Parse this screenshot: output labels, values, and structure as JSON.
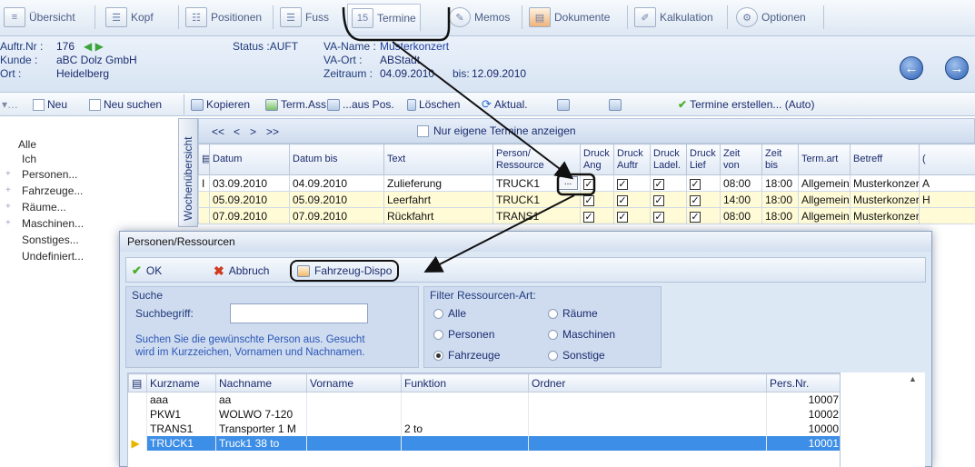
{
  "tabs": [
    {
      "label": "Übersicht",
      "icon": "overview-icon"
    },
    {
      "label": "Kopf",
      "icon": "header-doc-icon"
    },
    {
      "label": "Positionen",
      "icon": "positions-icon"
    },
    {
      "label": "Fuss",
      "icon": "footer-doc-icon"
    },
    {
      "label": "Termine",
      "icon": "calendar-icon",
      "icon_text": "15"
    },
    {
      "label": "Memos",
      "icon": "memo-icon"
    },
    {
      "label": "Dokumente",
      "icon": "documents-icon"
    },
    {
      "label": "Kalkulation",
      "icon": "calculation-icon"
    },
    {
      "label": "Optionen",
      "icon": "options-icon"
    }
  ],
  "info": {
    "auftr_label": "Auftr.Nr :",
    "auftr_value": "176",
    "kunde_label": "Kunde :",
    "kunde_value": "aBC Dolz GmbH",
    "ort_label": "Ort :",
    "ort_value": "Heidelberg",
    "status": "Status :AUFT",
    "va_name_label": "VA-Name :",
    "va_name_value": "Musterkonzert",
    "va_ort_label": "VA-Ort :",
    "va_ort_value": "ABStadt",
    "zeitraum_label": "Zeitraum :",
    "zeitraum_value": "04.09.2010",
    "bis_label": "bis:",
    "bis_value": "12.09.2010"
  },
  "actions": {
    "neu": "Neu",
    "neu_suchen": "Neu suchen",
    "kopieren": "Kopieren",
    "term_ass": "Term.Ass.",
    "aus_pos": "...aus Pos.",
    "loeschen": "Löschen",
    "aktual": "Aktual.",
    "termine_erstellen": "Termine erstellen... (Auto)"
  },
  "tree": [
    "Alle",
    "Ich",
    "Personen...",
    "Fahrzeuge...",
    "Räume...",
    "Maschinen...",
    "Sonstiges...",
    "Undefiniert..."
  ],
  "vertical_tab": "Wochenübersicht",
  "grid": {
    "nav": [
      "<<",
      "<",
      ">",
      ">>"
    ],
    "own_only": "Nur eigene Termine anzeigen",
    "columns": [
      "Datum",
      "Datum bis",
      "Text",
      "Person/ Ressource",
      "Druck Ang",
      "Druck Auftr",
      "Druck Ladel.",
      "Druck Lief",
      "Zeit von",
      "Zeit bis",
      "Term.art",
      "Betreff",
      "("
    ],
    "rows": [
      {
        "datum": "03.09.2010",
        "datum_bis": "04.09.2010",
        "text": "Zulieferung",
        "person": "TRUCK1",
        "zeit_von": "08:00",
        "zeit_bis": "18:00",
        "termart": "Allgemein",
        "betreff": "Musterkonzert",
        "extra": "A"
      },
      {
        "datum": "05.09.2010",
        "datum_bis": "05.09.2010",
        "text": "Leerfahrt",
        "person": "TRUCK1",
        "zeit_von": "14:00",
        "zeit_bis": "18:00",
        "termart": "Allgemein",
        "betreff": "Musterkonzert",
        "extra": "H"
      },
      {
        "datum": "07.09.2010",
        "datum_bis": "07.09.2010",
        "text": "Rückfahrt",
        "person": "TRANS1",
        "zeit_von": "08:00",
        "zeit_bis": "18:00",
        "termart": "Allgemein",
        "betreff": "Musterkonzert",
        "extra": ""
      }
    ],
    "ellipsis": "..."
  },
  "dialog": {
    "title": "Personen/Ressourcen",
    "ok": "OK",
    "abbruch": "Abbruch",
    "dispo": "Fahrzeug-Dispo",
    "suche_title": "Suche",
    "suchbegriff_label": "Suchbegriff:",
    "suchbegriff_value": "",
    "hint_line1": "Suchen Sie die gewünschte Person aus. Gesucht",
    "hint_line2": "wird im Kurzzeichen, Vornamen und Nachnamen.",
    "filter_title": "Filter Ressourcen-Art:",
    "filters": [
      "Alle",
      "Personen",
      "Fahrzeuge",
      "Räume",
      "Maschinen",
      "Sonstige"
    ],
    "filter_selected": "Fahrzeuge",
    "list_columns": [
      "Kurzname",
      "Nachname",
      "Vorname",
      "Funktion",
      "Ordner",
      "Pers.Nr."
    ],
    "list_rows": [
      {
        "kurz": "aaa",
        "nach": "aa",
        "vor": "",
        "funk": "",
        "ordner": "",
        "nr": "10007"
      },
      {
        "kurz": "PKW1",
        "nach": "WOLWO 7-120",
        "vor": "",
        "funk": "",
        "ordner": "",
        "nr": "10002"
      },
      {
        "kurz": "TRANS1",
        "nach": "Transporter 1 M",
        "vor": "",
        "funk": "2 to",
        "ordner": "",
        "nr": "10000"
      },
      {
        "kurz": "TRUCK1",
        "nach": "Truck1 38 to",
        "vor": "",
        "funk": "",
        "ordner": "",
        "nr": "10001"
      }
    ],
    "selected_row": "TRUCK1"
  },
  "colors": {
    "accent": "#2c5fb4",
    "selection": "#3d8ee6",
    "highlight_row": "#fffbd6",
    "ok_check": "#4caf2a",
    "cancel_x": "#d03a1e"
  }
}
